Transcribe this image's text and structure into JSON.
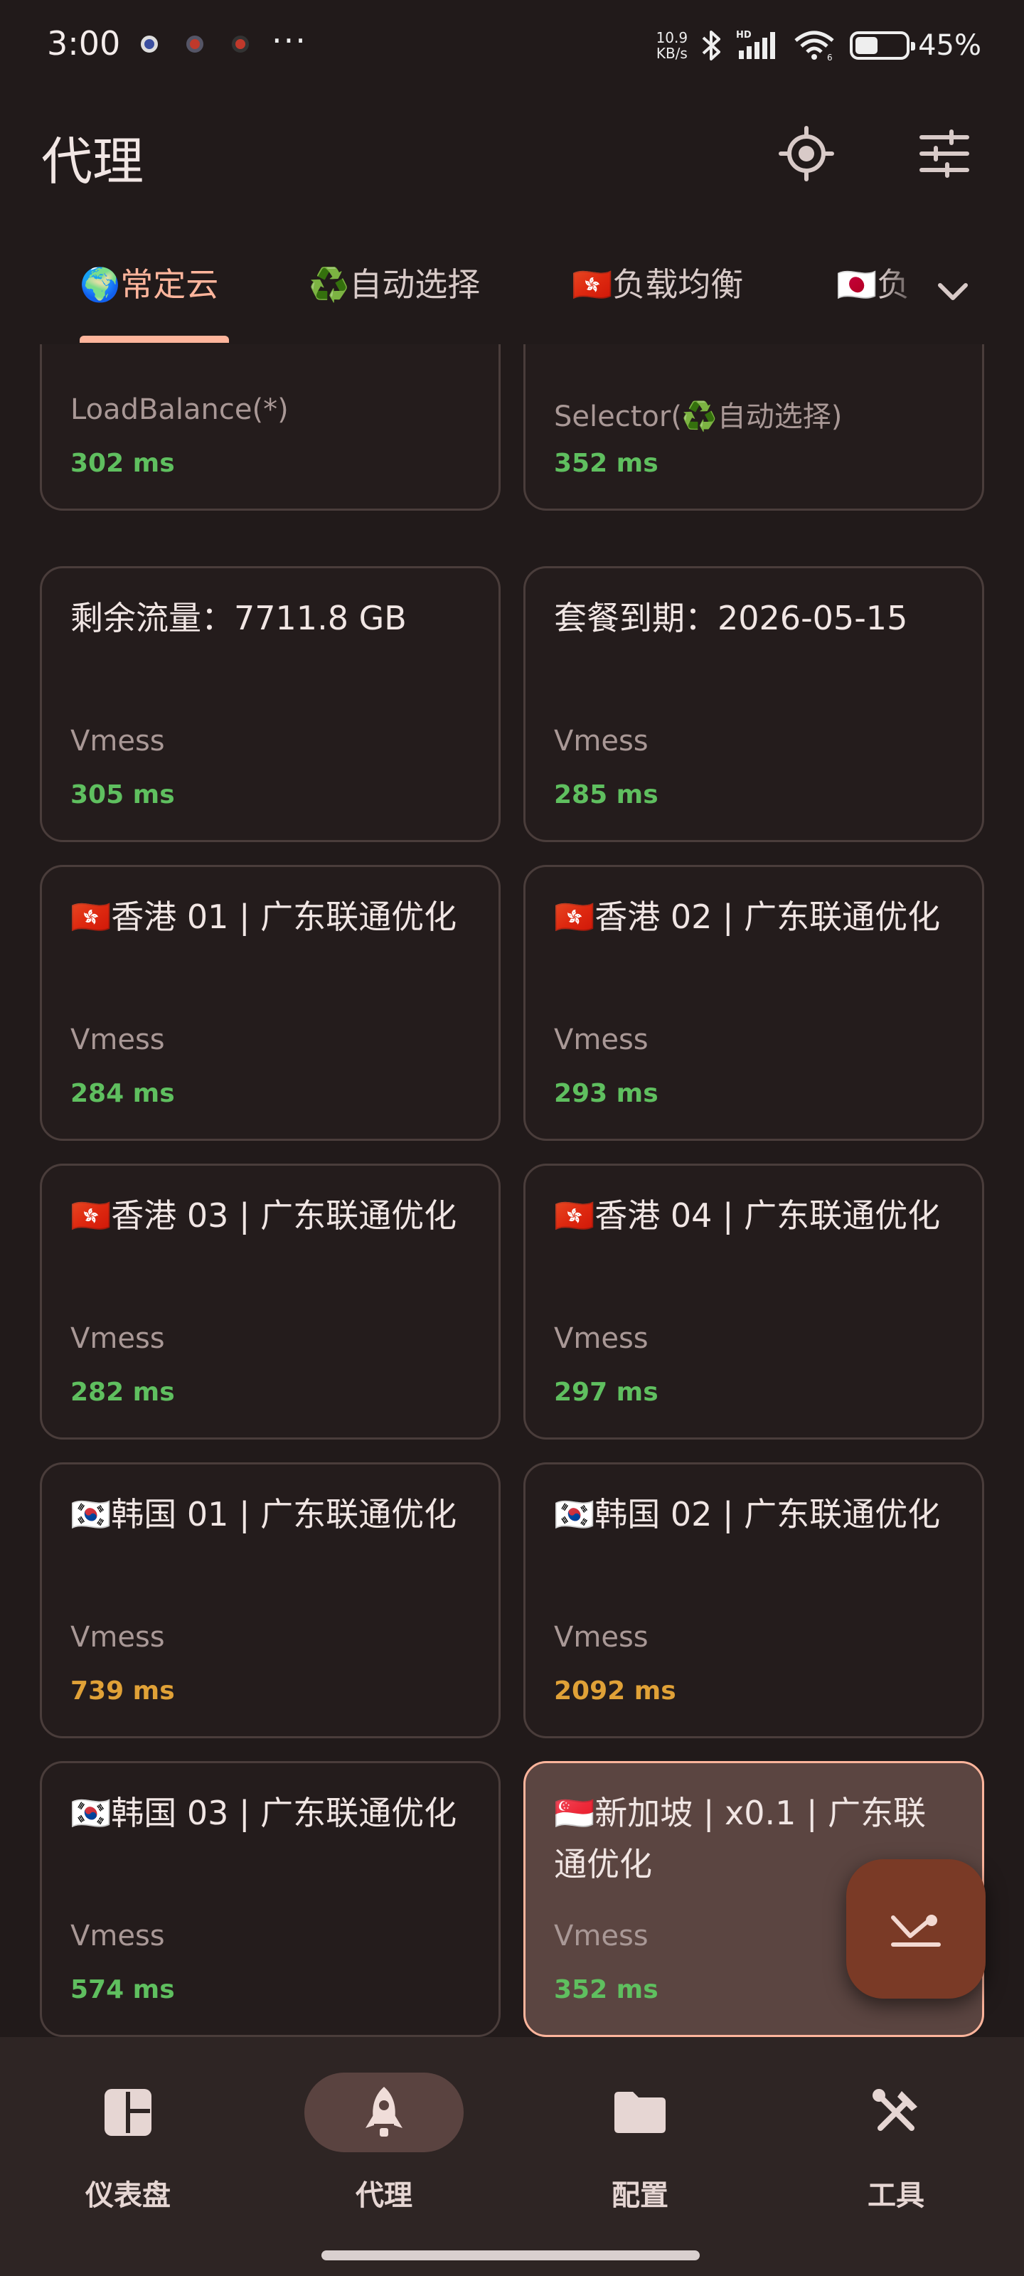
{
  "status_bar": {
    "time": "3:00",
    "more_indicator": "···",
    "net_speed_value": "10.9",
    "net_speed_unit": "KB/s",
    "battery_percent": "45%",
    "battery_level": 0.45,
    "icons": [
      "bluetooth-icon",
      "hd-icon",
      "signal-icon",
      "wifi-icon",
      "battery-icon"
    ]
  },
  "app_bar": {
    "title": "代理",
    "actions": [
      "locate-icon",
      "tune-icon"
    ]
  },
  "tabs": {
    "items": [
      {
        "label": "🌍常定云",
        "active": true
      },
      {
        "label": "♻️自动选择",
        "active": false
      },
      {
        "label": "🇭🇰负载均衡",
        "active": false
      },
      {
        "label": "🇯🇵负",
        "active": false
      }
    ],
    "expand_icon": "chevron-down-icon"
  },
  "proxies": [
    {
      "name": "",
      "type": "LoadBalance(*)",
      "delay": "302 ms",
      "selected": false
    },
    {
      "name": "",
      "type": "Selector(♻️自动选择)",
      "delay": "352 ms",
      "selected": false
    },
    {
      "name": "剩余流量：7711.8 GB",
      "type": "Vmess",
      "delay": "305 ms",
      "selected": false
    },
    {
      "name": "套餐到期：2026-05-15",
      "type": "Vmess",
      "delay": "285 ms",
      "selected": false
    },
    {
      "name": "🇭🇰香港 01 | 广东联通优化",
      "type": "Vmess",
      "delay": "284 ms",
      "selected": false
    },
    {
      "name": "🇭🇰香港 02 | 广东联通优化",
      "type": "Vmess",
      "delay": "293 ms",
      "selected": false
    },
    {
      "name": "🇭🇰香港 03 | 广东联通优化",
      "type": "Vmess",
      "delay": "282 ms",
      "selected": false
    },
    {
      "name": "🇭🇰香港 04 | 广东联通优化",
      "type": "Vmess",
      "delay": "297 ms",
      "selected": false
    },
    {
      "name": "🇰🇷韩国 01 | 广东联通优化",
      "type": "Vmess",
      "delay": "739 ms",
      "selected": false
    },
    {
      "name": "🇰🇷韩国 02 | 广东联通优化",
      "type": "Vmess",
      "delay": "2092 ms",
      "selected": false
    },
    {
      "name": "🇰🇷韩国 03 | 广东联通优化",
      "type": "Vmess",
      "delay": "574 ms",
      "selected": false
    },
    {
      "name": "🇸🇬新加坡 | x0.1 | 广东联通优化",
      "type": "Vmess",
      "delay": "352 ms",
      "selected": true
    }
  ],
  "fab": {
    "icon": "test-delay-icon"
  },
  "bottom_nav": {
    "items": [
      {
        "label": "仪表盘",
        "icon": "dashboard-icon",
        "active": false
      },
      {
        "label": "代理",
        "icon": "rocket-icon",
        "active": true
      },
      {
        "label": "配置",
        "icon": "folder-icon",
        "active": false
      },
      {
        "label": "工具",
        "icon": "tools-icon",
        "active": false
      }
    ]
  },
  "colors": {
    "background": "#211a1a",
    "accent": "#ffb59c",
    "delay_good": "#5fbf5f",
    "delay_slow": "#e0a137",
    "selected_card": "#5b4541",
    "fab": "#7a3a26"
  }
}
